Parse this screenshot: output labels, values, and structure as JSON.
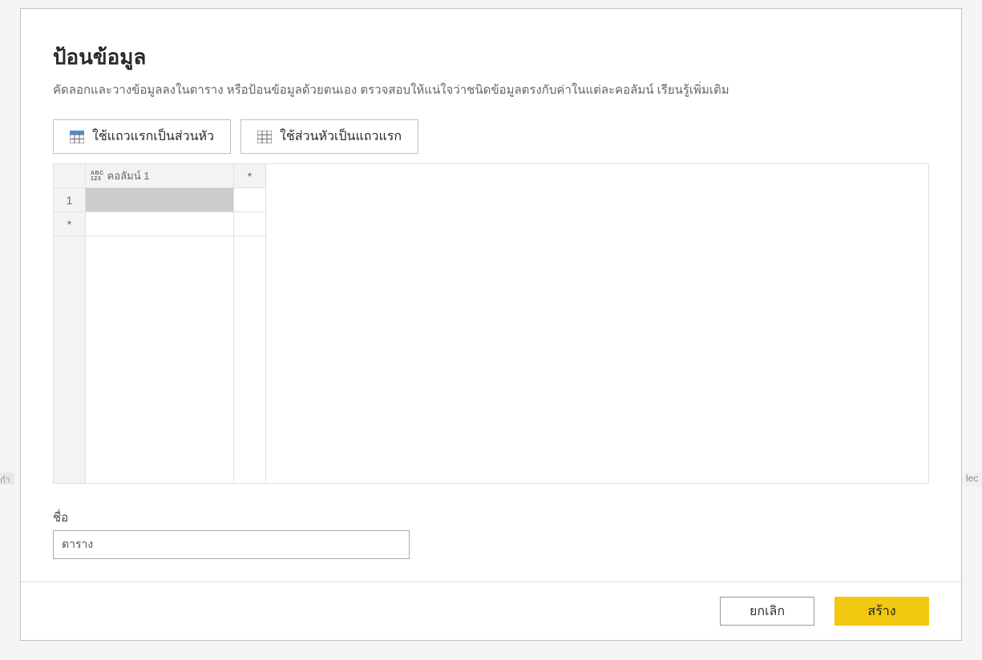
{
  "bg": {
    "left_hint": "กำ",
    "right_hint": "lec"
  },
  "dialog": {
    "title": "ป้อนข้อมูล",
    "subtitle": "คัดลอกและวางข้อมูลลงในตาราง หรือป้อนข้อมูลด้วยตนเอง ตรวจสอบให้แน่ใจว่าชนิดข้อมูลตรงกับค่าในแต่ละคอลัมน์ เรียนรู้เพิ่มเติม",
    "toolbar": {
      "use_first_row_as_header": "ใช้แถวแรกเป็นส่วนหัว",
      "use_header_as_first_row": "ใช้ส่วนหัวเป็นแถวแรก"
    },
    "grid": {
      "type_indicator": {
        "top": "ABC",
        "bottom": "123"
      },
      "column1_label": "คอลัมน์ 1",
      "add_col_symbol": "*",
      "row1_label": "1",
      "add_row_symbol": "*"
    },
    "name_field": {
      "label": "ชื่อ",
      "value": "ตาราง"
    },
    "footer": {
      "cancel": "ยกเลิก",
      "create": "สร้าง"
    }
  }
}
